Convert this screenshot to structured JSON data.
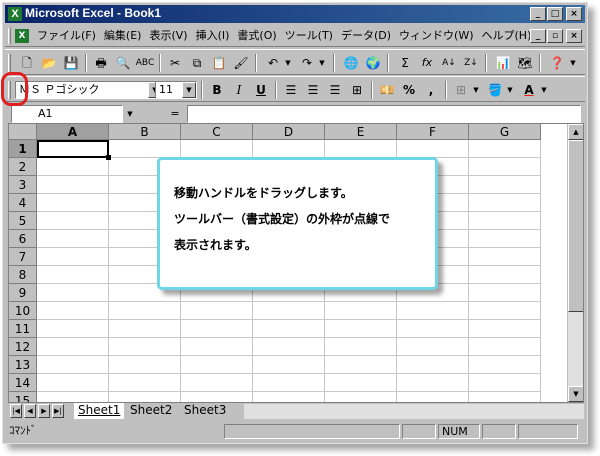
{
  "window": {
    "title": "Microsoft Excel - Book1",
    "app_icon": "excel-icon",
    "caption_buttons": {
      "minimize": "_",
      "maximize": "□",
      "close": "×"
    }
  },
  "menubar": {
    "items": [
      "ファイル(F)",
      "編集(E)",
      "表示(V)",
      "挿入(I)",
      "書式(O)",
      "ツール(T)",
      "データ(D)",
      "ウィンドウ(W)",
      "ヘルプ(H)"
    ],
    "doc_buttons": {
      "minimize": "_",
      "restore": "▫",
      "close": "×"
    }
  },
  "standard_toolbar": {
    "sum_glyph": "Σ",
    "function_glyph": "fx",
    "sort_asc": "A↓",
    "sort_desc": "Z↓"
  },
  "format_toolbar": {
    "font_name": "ＭＳ Ｐゴシック",
    "font_size": "11",
    "bold": "B",
    "italic": "I",
    "underline": "U",
    "percent": "%",
    "comma": ",",
    "font_color_glyph": "A"
  },
  "formula_bar": {
    "name_box": "A1",
    "equals": "="
  },
  "grid": {
    "columns": [
      "A",
      "B",
      "C",
      "D",
      "E",
      "F",
      "G"
    ],
    "rows": [
      "1",
      "2",
      "3",
      "4",
      "5",
      "6",
      "7",
      "8",
      "9",
      "10",
      "11",
      "12",
      "13",
      "14",
      "15"
    ],
    "active_cell": "A1"
  },
  "callout": {
    "lines": [
      "移動ハンドルをドラッグします。",
      "ツールバー（書式設定）の外枠が点線で",
      "表示されます。"
    ],
    "border_color": "#6fd6e6"
  },
  "sheet_tabs": [
    "Sheet1",
    "Sheet2",
    "Sheet3"
  ],
  "statusbar": {
    "mode": "ｺﾏﾝﾄﾞ",
    "num": "NUM"
  },
  "colors": {
    "title_bar": "#0a246a",
    "highlight_circle": "#e02020"
  }
}
